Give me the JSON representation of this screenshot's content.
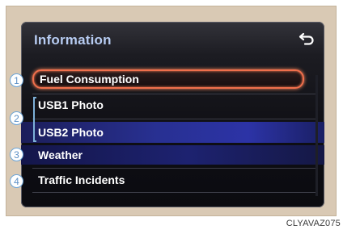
{
  "screen": {
    "title": "Information",
    "back_icon": "return-arrow-icon",
    "items": [
      {
        "label": "Fuel Consumption",
        "state": "selected"
      },
      {
        "label": "USB1 Photo"
      },
      {
        "label": "USB2 Photo"
      },
      {
        "label": "Weather"
      },
      {
        "label": "Traffic Incidents"
      }
    ]
  },
  "callouts": [
    "1",
    "2",
    "3",
    "4"
  ],
  "caption": "CLYAVAZ075",
  "colors": {
    "title": "#b7ccf2",
    "selection_border": "#f06f4c",
    "highlight_band": "#283092",
    "callout": "#6aa4d8",
    "bezel": "#d9c9b4"
  }
}
